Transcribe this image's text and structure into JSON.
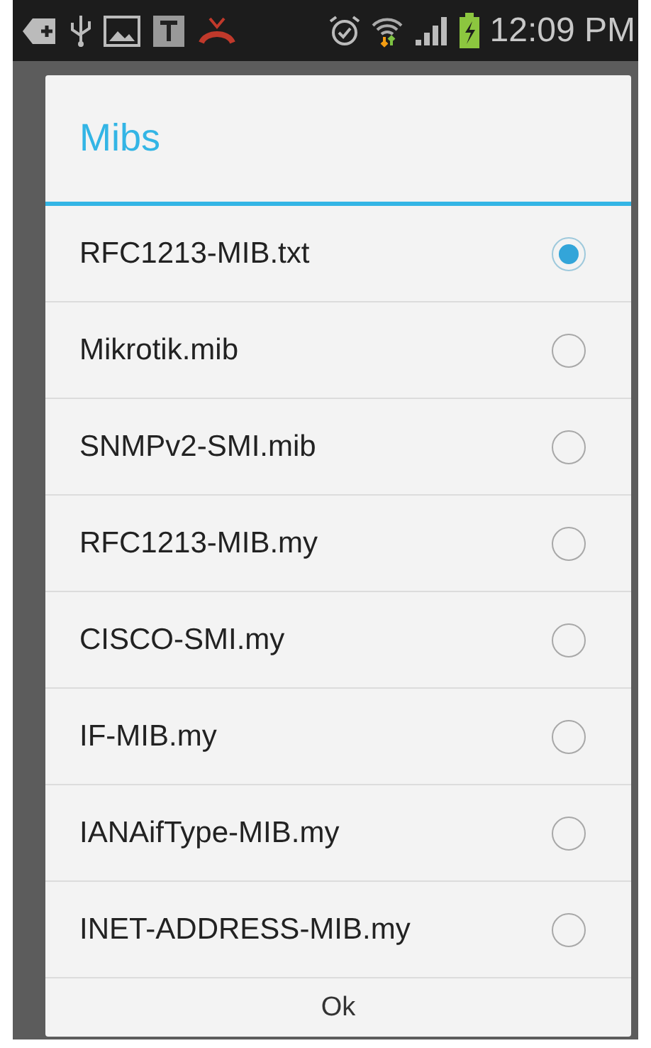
{
  "status_bar": {
    "time": "12:09 PM"
  },
  "dialog": {
    "title": "Mibs",
    "options": [
      {
        "label": "RFC1213-MIB.txt",
        "selected": true
      },
      {
        "label": "Mikrotik.mib",
        "selected": false
      },
      {
        "label": "SNMPv2-SMI.mib",
        "selected": false
      },
      {
        "label": "RFC1213-MIB.my",
        "selected": false
      },
      {
        "label": "CISCO-SMI.my",
        "selected": false
      },
      {
        "label": "IF-MIB.my",
        "selected": false
      },
      {
        "label": "IANAifType-MIB.my",
        "selected": false
      },
      {
        "label": "INET-ADDRESS-MIB.my",
        "selected": false
      }
    ],
    "button": "Ok"
  }
}
